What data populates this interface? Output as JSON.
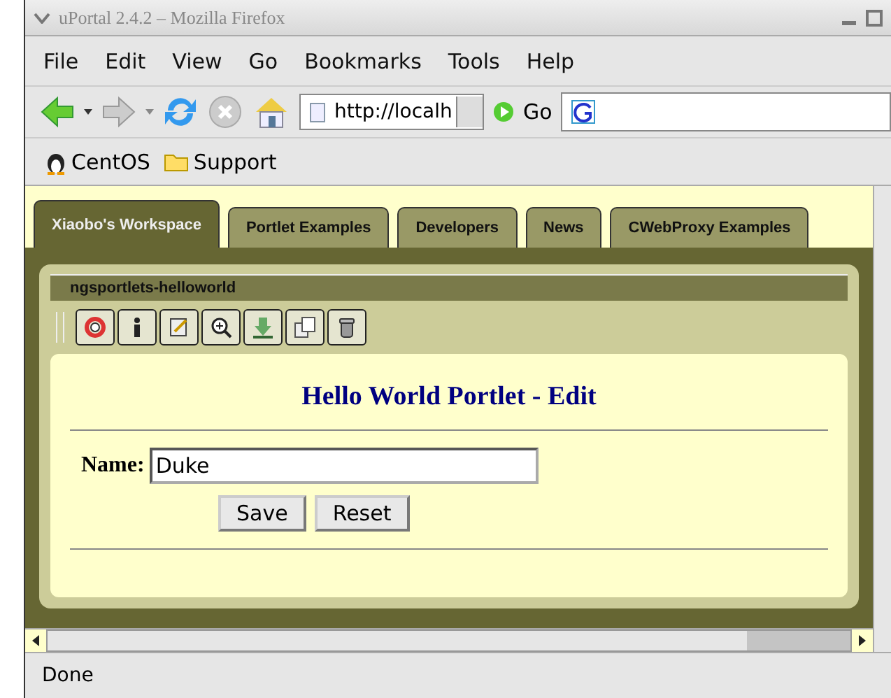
{
  "window": {
    "title": "uPortal 2.4.2 – Mozilla Firefox"
  },
  "menu": [
    "File",
    "Edit",
    "View",
    "Go",
    "Bookmarks",
    "Tools",
    "Help"
  ],
  "navbar": {
    "url": "http://localh",
    "go": "Go"
  },
  "bookmarks": [
    "CentOS",
    "Support"
  ],
  "tabs": [
    {
      "label": "Xiaobo's Workspace",
      "selected": true
    },
    {
      "label": "Portlet Examples",
      "selected": false
    },
    {
      "label": "Developers",
      "selected": false
    },
    {
      "label": "News",
      "selected": false
    },
    {
      "label": "CWebProxy Examples",
      "selected": false
    }
  ],
  "portlet": {
    "title": "ngsportlets-helloworld",
    "heading": "Hello World Portlet - Edit",
    "name_label": "Name:",
    "name_value": "Duke",
    "buttons": [
      "Save",
      "Reset"
    ]
  },
  "status_bar": "Done"
}
